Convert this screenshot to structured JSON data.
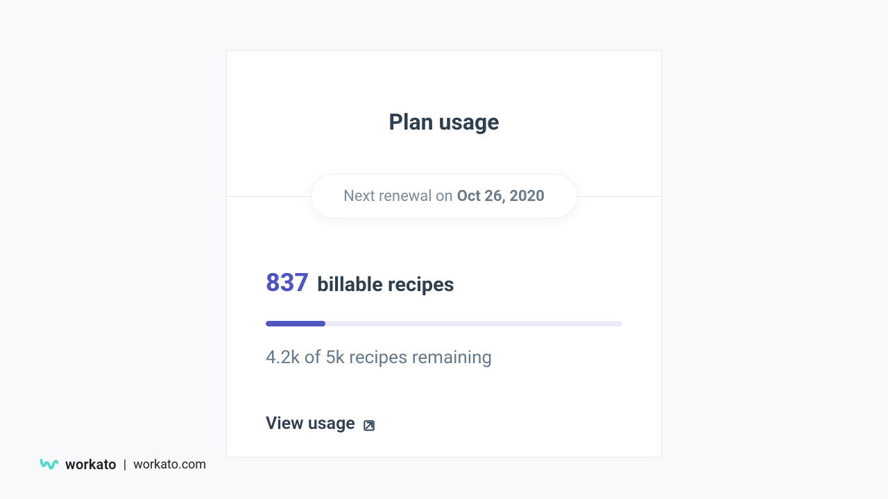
{
  "card": {
    "title": "Plan usage",
    "renewal_prefix": "Next renewal on",
    "renewal_date": "Oct 26, 2020",
    "usage_count": "837",
    "usage_label": "billable recipes",
    "progress_percent": 16.7,
    "remaining_text": "4.2k of 5k recipes remaining",
    "view_usage_label": "View usage"
  },
  "footer": {
    "brand": "workato",
    "domain": "workato.com"
  },
  "colors": {
    "accent": "#4f55c1",
    "brand_mark": "#55d9c9"
  }
}
